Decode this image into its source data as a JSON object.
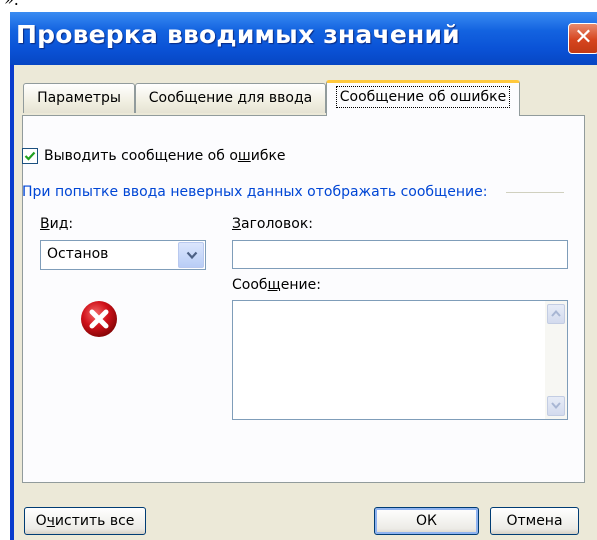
{
  "caption_fragment": "».",
  "window": {
    "title": "Проверка вводимых значений",
    "close_glyph": "✕"
  },
  "tabs": [
    {
      "label": "Параметры",
      "active": false
    },
    {
      "label": "Сообщение для ввода",
      "active": false
    },
    {
      "label": "Сообщение об ошибке",
      "active": true
    }
  ],
  "error_tab": {
    "show_error_checkbox": {
      "label_pre": "Выводить сообщение об о",
      "label_mnemonic": "ш",
      "label_post": "ибке",
      "checked": true
    },
    "group_label": "При попытке ввода неверных данных отображать сообщение:",
    "style": {
      "label_mnemonic": "В",
      "label_rest": "ид:",
      "selected": "Останов"
    },
    "title": {
      "label_mnemonic": "З",
      "label_rest": "аголовок:",
      "value": ""
    },
    "message": {
      "label_pre": "Сооб",
      "label_mnemonic": "щ",
      "label_post": "ение:",
      "value": ""
    },
    "icon": "error-stop-icon"
  },
  "buttons": {
    "clear_pre": "О",
    "clear_mnemonic": "ч",
    "clear_post": "истить все",
    "ok": "ОК",
    "cancel": "Отмена"
  },
  "colors": {
    "titlebar": "#0a52d6",
    "dialog_bg": "#ece9d8",
    "group_label": "#0046d5",
    "error_red": "#d0111a"
  }
}
